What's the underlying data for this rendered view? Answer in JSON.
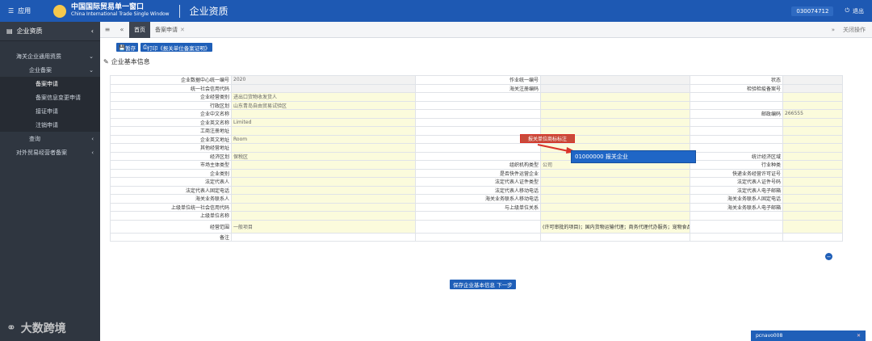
{
  "header": {
    "menu_label": "应用",
    "brand_cn": "中国国际贸易单一窗口",
    "brand_en": "China International Trade Single Window",
    "page_title": "企业资质",
    "user_text": "030074712",
    "logout_label": "退出"
  },
  "sidebar": {
    "title": "企业资质",
    "items": [
      {
        "label": "海关企业通用资质"
      },
      {
        "label": "企业备案"
      },
      {
        "label": "备案申请"
      },
      {
        "label": "备案信息变更申请"
      },
      {
        "label": "接证申请"
      },
      {
        "label": "注销申请"
      },
      {
        "label": "查询"
      },
      {
        "label": "对外贸易经营者备案"
      }
    ],
    "footer": "大数跨境"
  },
  "tabs": {
    "home": "首页",
    "record": "备案申请",
    "close_ops": "关闭操作"
  },
  "toolbar": {
    "save": "暂存",
    "print": "打印《报关单位备案证明》"
  },
  "section": {
    "title": "企业基本信息"
  },
  "form": {
    "rows": [
      [
        "企业数据中心统一编号",
        "2020",
        "作业统一编号",
        "",
        "状态",
        ""
      ],
      [
        "统一社会信用代码",
        "",
        "海关注册编码",
        "",
        "检验检疫备案号",
        ""
      ],
      [
        "企业经营类别",
        "进出口货物收发货人",
        "",
        "",
        "",
        ""
      ],
      [
        "行政区划",
        "山东青岛自由贸易试验区",
        "",
        "",
        "",
        ""
      ],
      [
        "企业中文名称",
        "",
        "",
        "",
        "邮政编码",
        "266555"
      ],
      [
        "企业英文名称",
        "Limited",
        "",
        "",
        "",
        ""
      ],
      [
        "工商注册地址",
        "",
        "",
        "",
        "",
        ""
      ],
      [
        "企业英文地址",
        "Room",
        "",
        "",
        "",
        ""
      ],
      [
        "其他经营地址",
        "",
        "",
        "",
        "",
        ""
      ],
      [
        "经济区划",
        "保税区",
        "",
        "",
        "统计经济区域",
        ""
      ],
      [
        "市场主体类型",
        "",
        "组织机构类型",
        "公司",
        "行业种类",
        ""
      ],
      [
        "企业类别",
        "",
        "是否快件运营企业",
        "",
        "快递业务经营许可证号",
        ""
      ],
      [
        "法定代表人",
        "",
        "法定代表人证件类型",
        "",
        "法定代表人证件号码",
        ""
      ],
      [
        "法定代表人固定电话",
        "",
        "法定代表人移动电话",
        "",
        "法定代表人电子邮箱",
        ""
      ],
      [
        "海关业务联系人",
        "",
        "海关业务联系人移动电话",
        "",
        "海关业务联系人固定电话",
        ""
      ],
      [
        "上级单位统一社会信用代码",
        "",
        "与上级单位关系",
        "",
        "海关业务联系人电子邮箱",
        ""
      ],
      [
        "上级单位名称",
        "",
        "",
        "",
        "",
        ""
      ],
      [
        "经营范围",
        "一般项目",
        "",
        "",
        "",
        ""
      ],
      [
        "备注",
        "",
        "",
        "",
        "",
        ""
      ]
    ],
    "scope_text": "(许可审批的项目)；国内货物运输代理；商务代理代办服务；宠物食品及用品批发；互联网销售(除...416字节)"
  },
  "dropdown": {
    "option": "01000000 报关企业"
  },
  "redbox_label": "报关单位商标标注",
  "buttons": {
    "save_next": "保存企业基本信息 下一步"
  },
  "chat": {
    "title": "pcnavo008"
  },
  "colors": {
    "primary": "#1e59b3",
    "sidebar": "#2f3640",
    "field_bg": "#fbfbdc",
    "highlight": "#d9332a"
  }
}
